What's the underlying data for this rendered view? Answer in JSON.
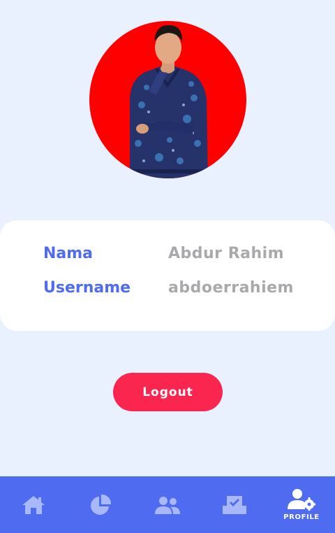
{
  "profile": {
    "fields": [
      {
        "label": "Nama",
        "value": "Abdur Rahim"
      },
      {
        "label": "Username",
        "value": "abdoerrahiem"
      }
    ]
  },
  "actions": {
    "logout_label": "Logout"
  },
  "bottom_nav": {
    "items": [
      {
        "icon": "home-icon",
        "label": "",
        "active": false
      },
      {
        "icon": "pie-chart-icon",
        "label": "",
        "active": false
      },
      {
        "icon": "users-icon",
        "label": "",
        "active": false
      },
      {
        "icon": "ballot-box-icon",
        "label": "",
        "active": false
      },
      {
        "icon": "user-settings-icon",
        "label": "PROFILE",
        "active": true
      }
    ]
  },
  "colors": {
    "background": "#EAF1FE",
    "accent": "#4F6BEE",
    "logout": "#FB2650",
    "avatar_bg": "#FF0000",
    "value_text": "#A9A9AC",
    "inactive_icon": "#A9B8FA"
  }
}
